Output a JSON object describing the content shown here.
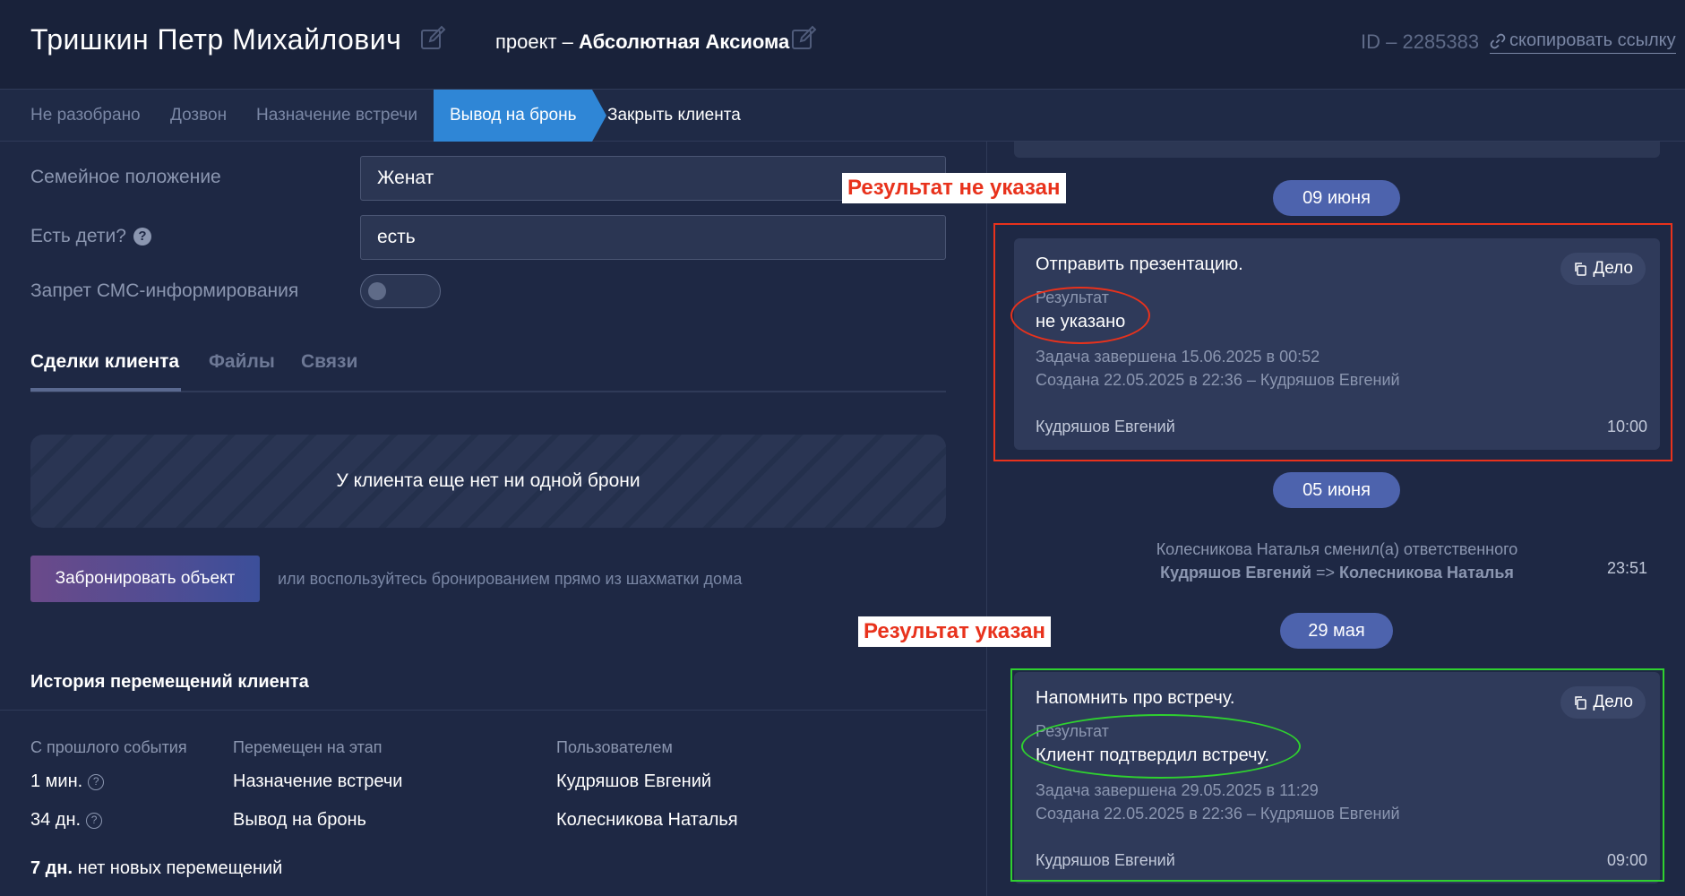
{
  "header": {
    "client_name": "Тришкин Петр Михайлович",
    "project_prefix": "проект – ",
    "project_name": "Абсолютная Аксиома",
    "client_id": "ID – 2285383",
    "copy_link": "скопировать ссылку"
  },
  "stages": [
    {
      "label": "Не разобрано"
    },
    {
      "label": "Дозвон"
    },
    {
      "label": "Назначение встречи"
    },
    {
      "label": "Вывод на бронь"
    },
    {
      "label": "Закрыть клиента"
    }
  ],
  "form": {
    "marital_label": "Семейное положение",
    "marital_value": "Женат",
    "children_label": "Есть дети?",
    "children_value": "есть",
    "sms_label": "Запрет СМС-информирования"
  },
  "tabs": [
    {
      "label": "Сделки клиента"
    },
    {
      "label": "Файлы"
    },
    {
      "label": "Связи"
    }
  ],
  "deals": {
    "empty_text": "У клиента еще нет ни одной брони",
    "book_button": "Забронировать объект",
    "book_hint": "или воспользуйтесь бронированием прямо из шахматки дома"
  },
  "annotations": {
    "not_set": "Результат не указан",
    "set": "Результат указан"
  },
  "history": {
    "title": "История перемещений клиента",
    "columns": [
      "С прошлого события",
      "Перемещен на этап",
      "Пользователем"
    ],
    "rows": [
      {
        "since": "1 мин.",
        "stage": "Назначение встречи",
        "user": "Кудряшов Евгений"
      },
      {
        "since": "34 дн.",
        "stage": "Вывод на бронь",
        "user": "Колесникова Наталья"
      }
    ],
    "footer_bold": "7 дн.",
    "footer_text": " нет новых перемещений"
  },
  "timeline": {
    "date1": "09 июня",
    "task1": {
      "title": "Отправить презентацию.",
      "case_button": "Дело",
      "result_label": "Результат",
      "result_value": "не указано",
      "completed": "Задача завершена 15.06.2025 в 00:52",
      "created": "Создана 22.05.2025 в 22:36 – Кудряшов Евгений",
      "owner": "Кудряшов Евгений",
      "time": "10:00"
    },
    "date2": "05 июня",
    "event": {
      "text": "Колесникова Наталья сменил(а) ответственного",
      "from": "Кудряшов Евгений",
      "arrow": " => ",
      "to": "Колесникова Наталья",
      "time": "23:51"
    },
    "date3": "29 мая",
    "task2": {
      "title": "Напомнить про встречу.",
      "case_button": "Дело",
      "result_label": "Результат",
      "result_value": "Клиент подтвердил встречу.",
      "completed": "Задача завершена 29.05.2025 в 11:29",
      "created": "Создана 22.05.2025 в 22:36 – Кудряшов Евгений",
      "owner": "Кудряшов Евгений",
      "time": "09:00"
    }
  },
  "colors": {
    "background": "#1e2844",
    "accent": "#2f86d6",
    "date_pill": "#4d63ad",
    "annotation_red": "#e8321c",
    "annotation_green": "#2fd12f"
  }
}
